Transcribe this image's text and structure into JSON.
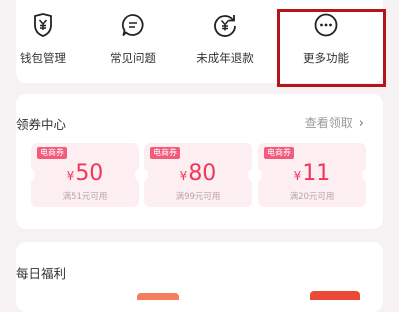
{
  "quick_actions": [
    {
      "label": "钱包管理",
      "icon": "wallet-yen-icon"
    },
    {
      "label": "常见问题",
      "icon": "chat-bubble-icon"
    },
    {
      "label": "未成年退款",
      "icon": "refund-yen-icon"
    },
    {
      "label": "更多功能",
      "icon": "more-dots-icon"
    }
  ],
  "coupon_center": {
    "title": "领券中心",
    "view_claimed": "查看领取",
    "coupons": [
      {
        "tag": "电商券",
        "currency": "¥",
        "amount": "50",
        "condition": "满51元可用"
      },
      {
        "tag": "电商券",
        "currency": "¥",
        "amount": "80",
        "condition": "满99元可用"
      },
      {
        "tag": "电商券",
        "currency": "¥",
        "amount": "11",
        "condition": "满20元可用"
      }
    ]
  },
  "daily_benefits": {
    "title": "每日福利"
  },
  "colors": {
    "accent": "#f0365a",
    "highlight_box": "#b4151b",
    "background": "#f6f1f3"
  }
}
